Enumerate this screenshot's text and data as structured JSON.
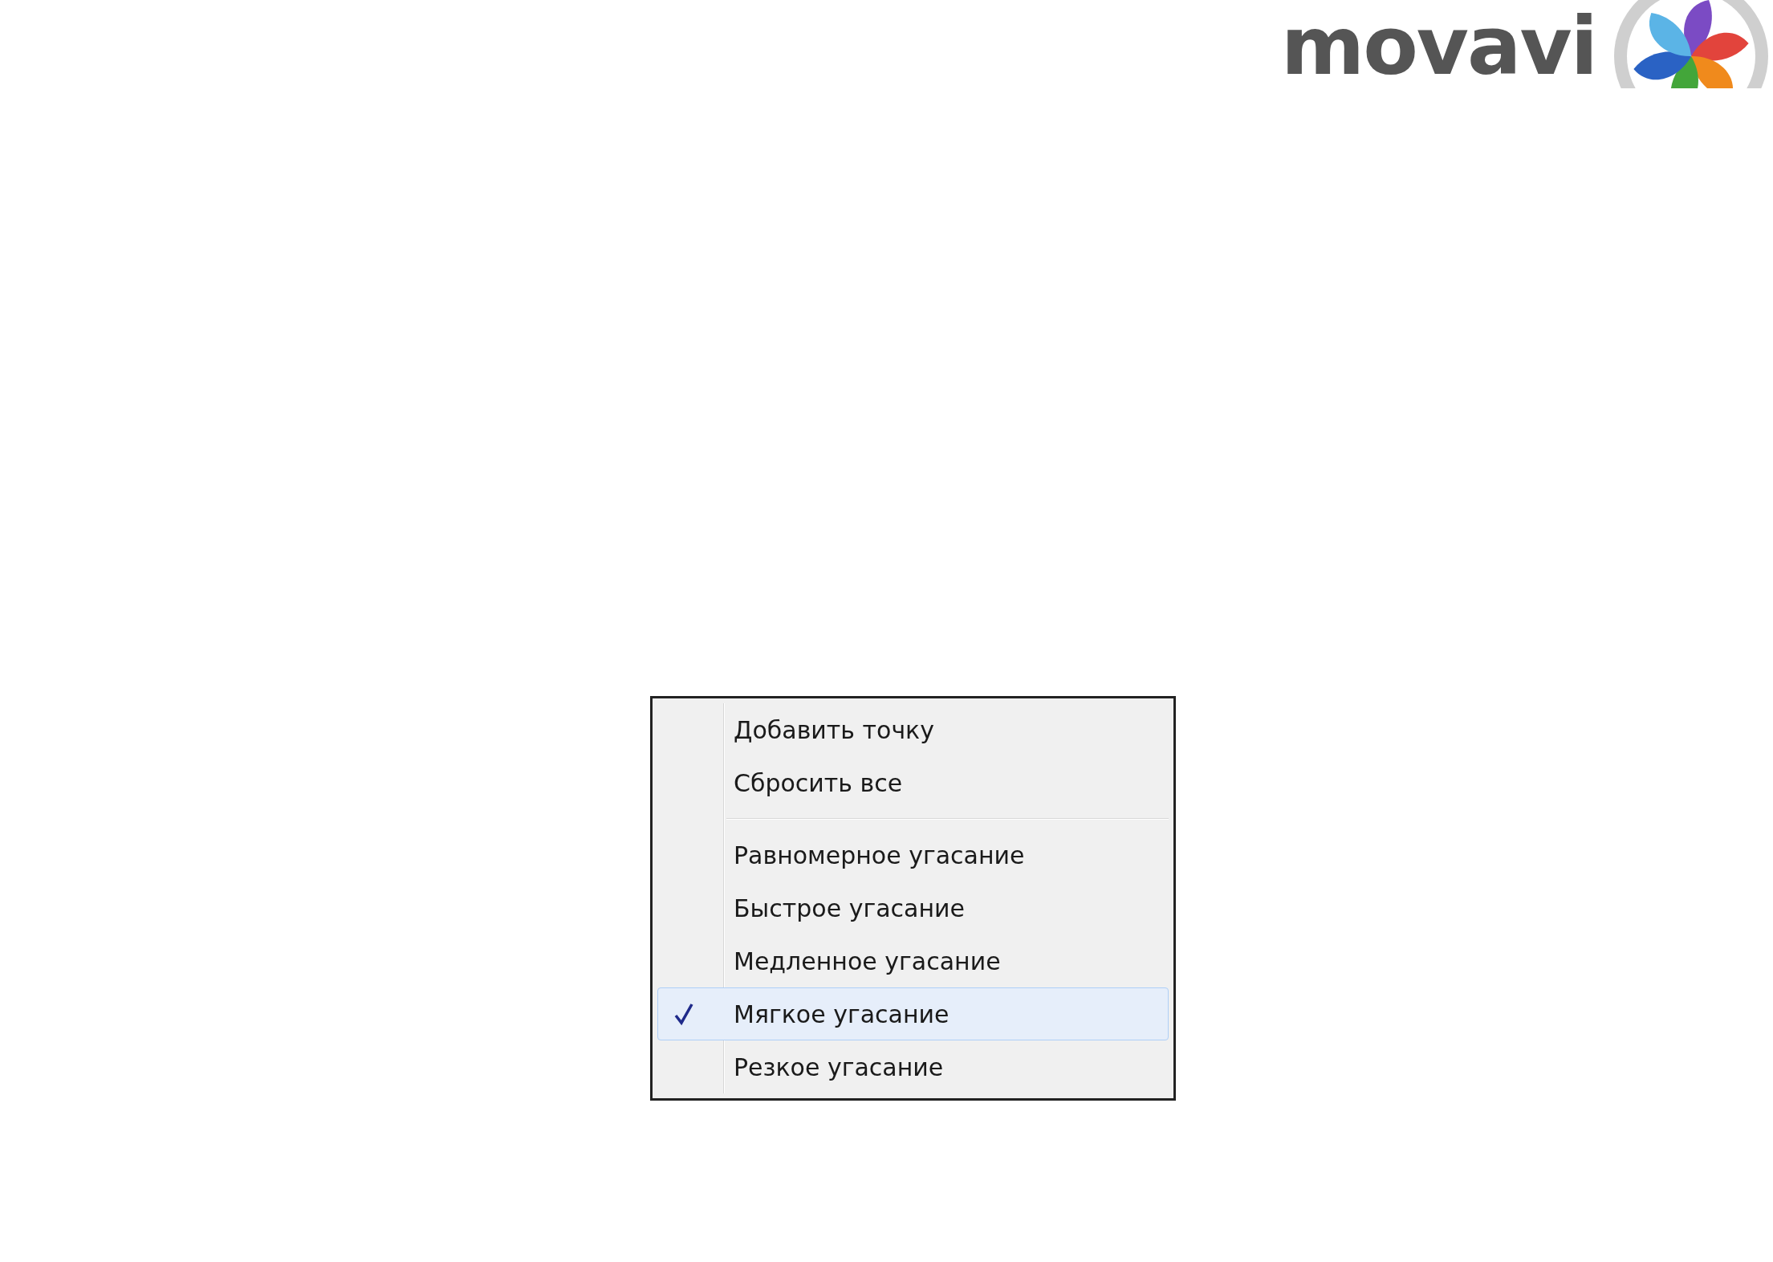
{
  "logo": {
    "text": "movavi"
  },
  "menu": {
    "items": [
      {
        "kind": "item",
        "label": "Добавить точку",
        "checked": false,
        "selected": false
      },
      {
        "kind": "item",
        "label": "Сбросить все",
        "checked": false,
        "selected": false
      },
      {
        "kind": "separator"
      },
      {
        "kind": "item",
        "label": "Равномерное угасание",
        "checked": false,
        "selected": false
      },
      {
        "kind": "item",
        "label": "Быстрое угасание",
        "checked": false,
        "selected": false
      },
      {
        "kind": "item",
        "label": "Медленное угасание",
        "checked": false,
        "selected": false
      },
      {
        "kind": "item",
        "label": "Мягкое угасание",
        "checked": true,
        "selected": true
      },
      {
        "kind": "item",
        "label": "Резкое угасание",
        "checked": false,
        "selected": false
      }
    ]
  }
}
